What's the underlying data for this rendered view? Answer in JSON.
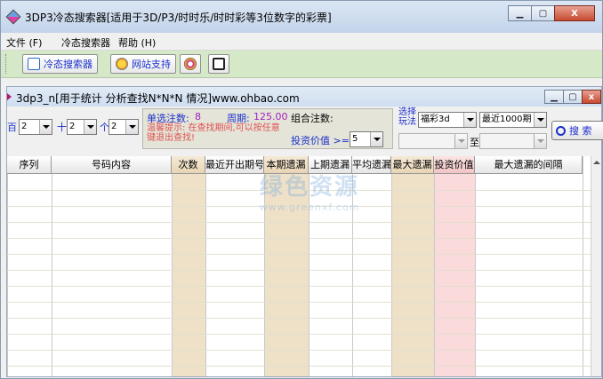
{
  "app": {
    "title": "3DP3冷态搜索器[适用于3D/P3/时时乐/时时彩等3位数字的彩票]",
    "caption": {
      "minimize": "▁",
      "maximize": "▢",
      "close": "X"
    }
  },
  "menu": {
    "items": [
      "文件 (F)",
      "冷态搜索器",
      "帮助 (H)"
    ]
  },
  "toolbar": {
    "cold_search_label": "冷态搜索器",
    "website_label": "网站支持",
    "icon_names": [
      "search-icon",
      "globe-icon",
      "browser-icon",
      "exit-icon"
    ]
  },
  "child": {
    "title": "3dp3_n[用于统计 分析查找N*N*N 情况]www.ohbao.com",
    "caption": {
      "minimize": "▁",
      "maximize": "▢",
      "close": "x"
    }
  },
  "filter": {
    "hundreds_label": "百",
    "hundreds_value": "2",
    "tens_label": "十",
    "tens_value": "2",
    "units_label": "个",
    "units_value": "2",
    "single_count_label": "单选注数:",
    "single_count_value": "8",
    "period_label": "周期:",
    "period_value": "125.00",
    "combo_count_label": "组合注数:",
    "warning": "温馨提示: 在查找期间,可以按任意键退出查找!",
    "invest_label": "投资价值 >=",
    "invest_value": "5",
    "play_label_1": "选择",
    "play_label_2": "玩法",
    "play_value": "福彩3d",
    "range_value": "最近1000期",
    "range_to_label": "至",
    "search_label": "搜 索"
  },
  "grid": {
    "columns": [
      "序列",
      "号码内容",
      "次数",
      "最近开出期号",
      "本期遗漏",
      "上期遗漏",
      "平均遗漏",
      "最大遗漏",
      "投资价值",
      "最大遗漏的间隔"
    ],
    "rows": []
  },
  "watermark": {
    "big": "绿色资源",
    "small": "www.greenxf.com"
  },
  "colors": {
    "toolbar_bg": "#d5e8c7",
    "tan_column": "#efe0c8",
    "pink_column": "#fadada",
    "info_panel": "#e4e4d8"
  }
}
